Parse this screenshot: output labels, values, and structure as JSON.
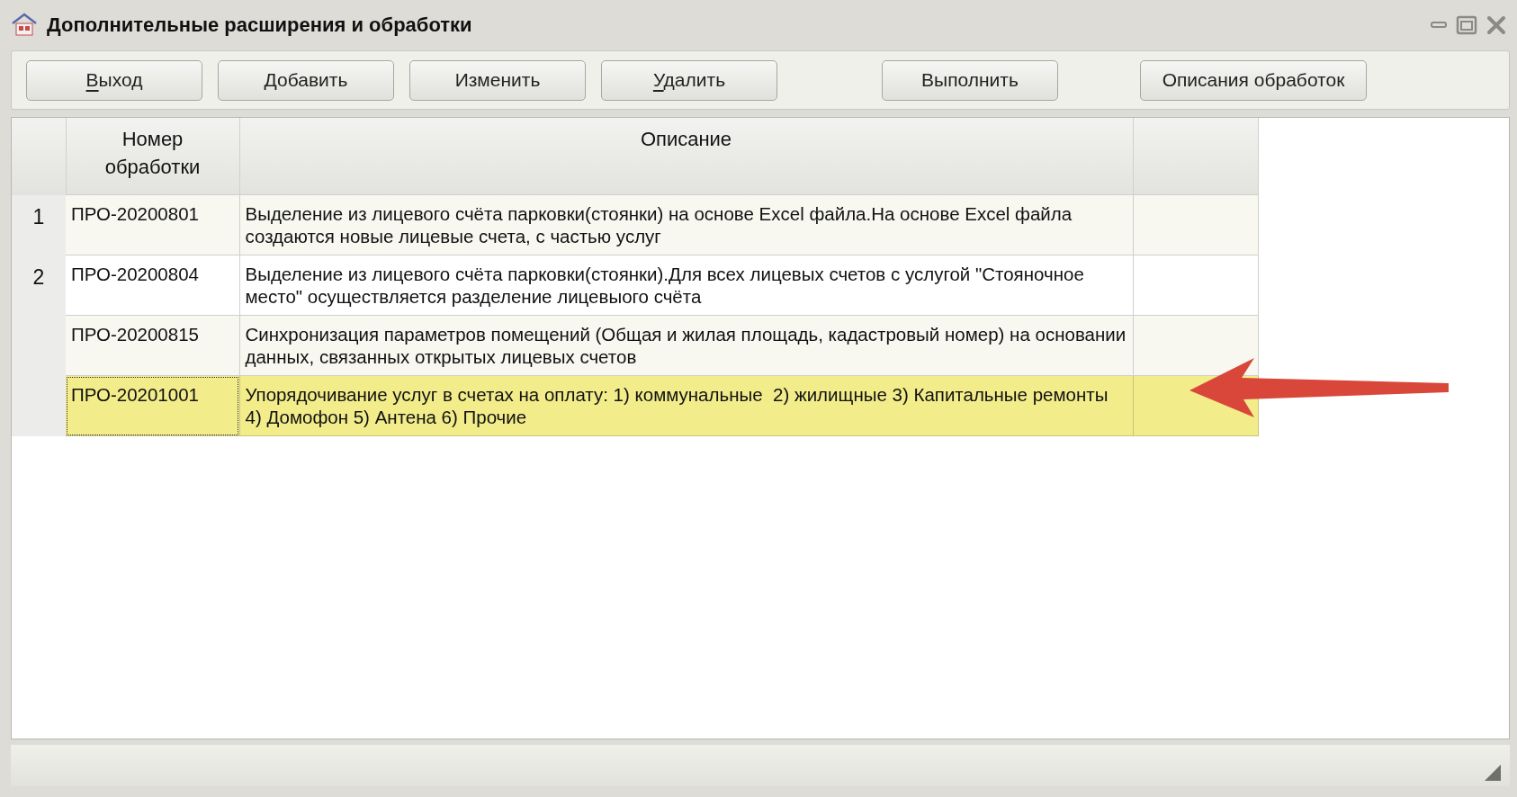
{
  "window": {
    "title": "Дополнительные расширения и обработки"
  },
  "toolbar": [
    {
      "label": "Выход",
      "mnemonic": true
    },
    {
      "label": "Добавить",
      "mnemonic": false
    },
    {
      "label": "Изменить",
      "mnemonic": false
    },
    {
      "label": "Удалить",
      "mnemonic": true
    },
    {
      "label": "Выполнить",
      "mnemonic": false
    },
    {
      "label": "Описания обработок",
      "mnemonic": false
    }
  ],
  "table": {
    "columns": [
      "Номер обработки",
      "Описание"
    ],
    "rows": [
      {
        "index": "1",
        "number": "ПРО-20200801",
        "description": "Выделение из лицевого счёта парковки(стоянки) на основе Excel файла.На основе Excel файла создаются новые лицевые счета, с частью услуг",
        "selected": false
      },
      {
        "index": "2",
        "number": "ПРО-20200804",
        "description": "Выделение из лицевого счёта парковки(стоянки).Для всех лицевых счетов с услугой \"Стояночное место\" осуществляется разделение лицевыого счёта",
        "selected": false
      },
      {
        "number": "ПРО-20200815",
        "description": "Синхронизация параметров помещений (Общая и жилая площадь, кадастровый номер) на основании данных, связанных открытых лицевых счетов",
        "selected": false
      },
      {
        "number": "ПРО-20201001",
        "description": "Упорядочивание услуг в счетах на оплату: 1) коммунальные  2) жилищные 3) Капитальные ремонты 4) Домофон 5) Антена 6) Прочие",
        "selected": true
      }
    ]
  },
  "annotation": {
    "kind": "arrow",
    "color": "#d9473a"
  }
}
